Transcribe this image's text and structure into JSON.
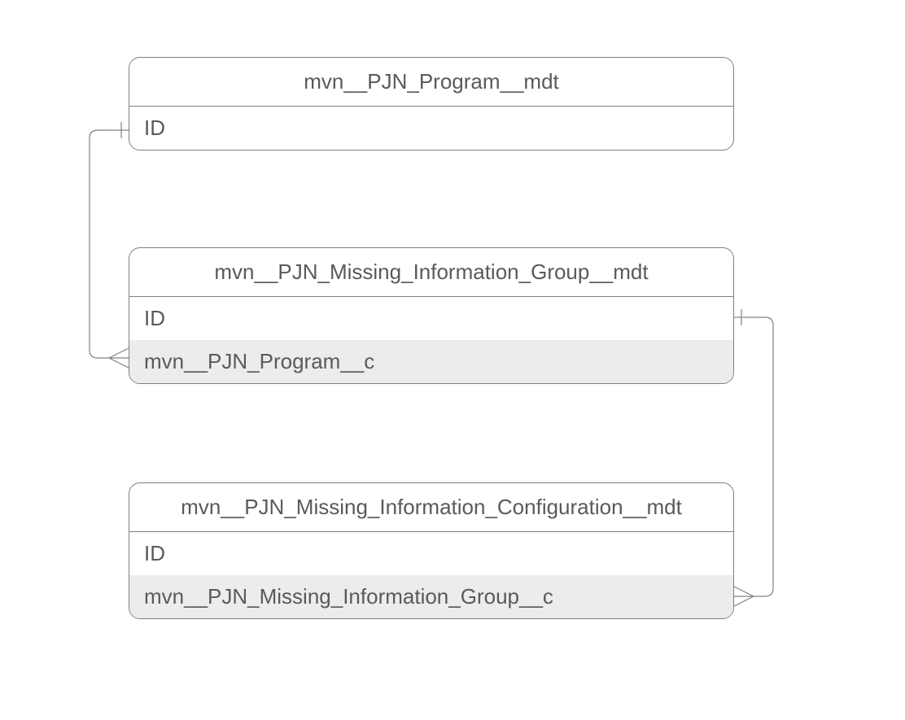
{
  "entities": [
    {
      "id": "program",
      "title": "mvn__PJN_Program__mdt",
      "rows": [
        {
          "label": "ID",
          "shaded": false
        }
      ]
    },
    {
      "id": "group",
      "title": "mvn__PJN_Missing_Information_Group__mdt",
      "rows": [
        {
          "label": "ID",
          "shaded": false
        },
        {
          "label": "mvn__PJN_Program__c",
          "shaded": true
        }
      ]
    },
    {
      "id": "config",
      "title": "mvn__PJN_Missing_Information_Configuration__mdt",
      "rows": [
        {
          "label": "ID",
          "shaded": false
        },
        {
          "label": "mvn__PJN_Missing_Information_Group__c",
          "shaded": true
        }
      ]
    }
  ],
  "relationships": [
    {
      "from": "program.ID",
      "to": "group.mvn__PJN_Program__c",
      "type": "one-to-many"
    },
    {
      "from": "group.ID",
      "to": "config.mvn__PJN_Missing_Information_Group__c",
      "type": "one-to-many"
    }
  ]
}
